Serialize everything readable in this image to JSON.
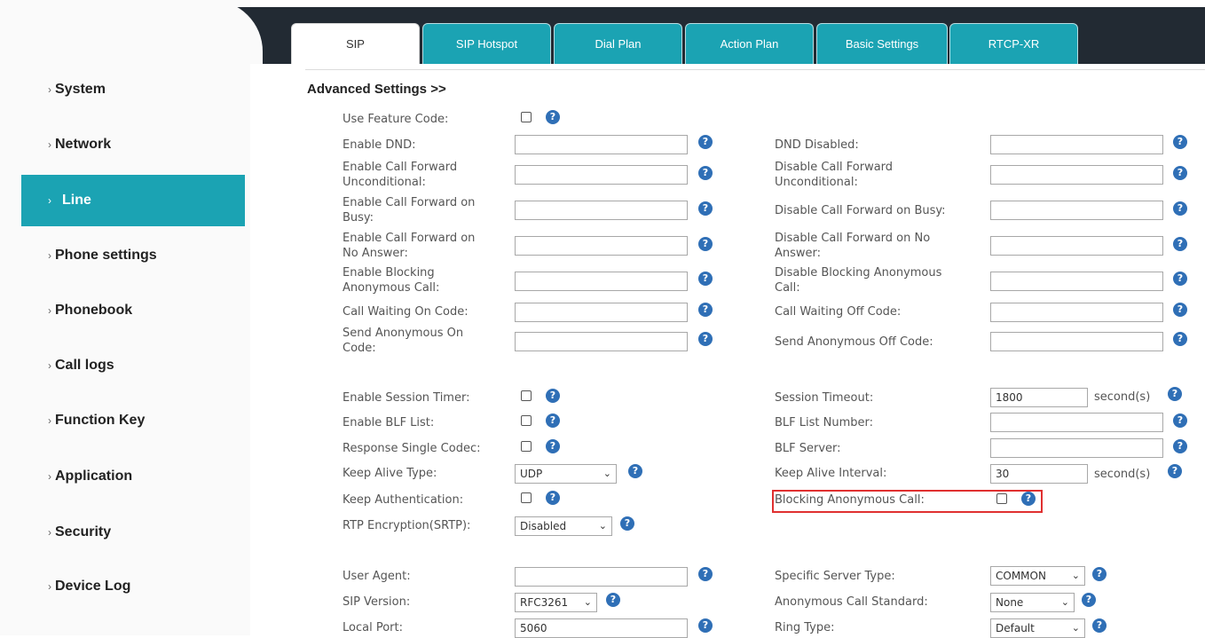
{
  "sidebar": {
    "items": [
      {
        "label": "System"
      },
      {
        "label": "Network"
      },
      {
        "label": "Line"
      },
      {
        "label": "Phone settings"
      },
      {
        "label": "Phonebook"
      },
      {
        "label": "Call logs"
      },
      {
        "label": "Function Key"
      },
      {
        "label": "Application"
      },
      {
        "label": "Security"
      },
      {
        "label": "Device Log"
      }
    ],
    "active": "Line"
  },
  "tabs": [
    {
      "label": "SIP"
    },
    {
      "label": "SIP Hotspot"
    },
    {
      "label": "Dial Plan"
    },
    {
      "label": "Action Plan"
    },
    {
      "label": "Basic Settings"
    },
    {
      "label": "RTCP-XR"
    }
  ],
  "section_title": "Advanced Settings >>",
  "fields": {
    "use_feature_code": {
      "label": "Use Feature Code:",
      "checked": false
    },
    "enable_dnd": {
      "label": "Enable DND:",
      "value": ""
    },
    "dnd_disabled": {
      "label": "DND Disabled:",
      "value": ""
    },
    "enable_cfu": {
      "label_1": "Enable Call Forward",
      "label_2": "Unconditional:",
      "value": ""
    },
    "disable_cfu": {
      "label_1": "Disable Call Forward",
      "label_2": "Unconditional:",
      "value": ""
    },
    "enable_cfb": {
      "label_1": "Enable Call Forward on",
      "label_2": "Busy:",
      "value": ""
    },
    "disable_cfb": {
      "label": "Disable Call Forward on Busy:",
      "value": ""
    },
    "enable_cfna": {
      "label_1": "Enable Call Forward on",
      "label_2": "No Answer:",
      "value": ""
    },
    "disable_cfna": {
      "label_1": "Disable Call Forward on No",
      "label_2": "Answer:",
      "value": ""
    },
    "enable_block_anon": {
      "label_1": "Enable Blocking",
      "label_2": "Anonymous Call:",
      "value": ""
    },
    "disable_block_anon": {
      "label_1": "Disable Blocking Anonymous",
      "label_2": "Call:",
      "value": ""
    },
    "call_waiting_on": {
      "label": "Call Waiting On Code:",
      "value": ""
    },
    "call_waiting_off": {
      "label": "Call Waiting Off Code:",
      "value": ""
    },
    "send_anon_on": {
      "label_1": "Send Anonymous On",
      "label_2": "Code:",
      "value": ""
    },
    "send_anon_off": {
      "label": "Send Anonymous Off Code:",
      "value": ""
    },
    "enable_session_timer": {
      "label": "Enable Session Timer:",
      "checked": false
    },
    "session_timeout": {
      "label": "Session Timeout:",
      "value": "1800",
      "unit": "second(s)"
    },
    "enable_blf_list": {
      "label": "Enable BLF List:",
      "checked": false
    },
    "blf_list_number": {
      "label": "BLF List Number:",
      "value": ""
    },
    "response_single_codec": {
      "label": "Response Single Codec:",
      "checked": false
    },
    "blf_server": {
      "label": "BLF Server:",
      "value": ""
    },
    "keep_alive_type": {
      "label": "Keep Alive Type:",
      "value": "UDP"
    },
    "keep_alive_interval": {
      "label": "Keep Alive Interval:",
      "value": "30",
      "unit": "second(s)"
    },
    "keep_authentication": {
      "label": "Keep Authentication:",
      "checked": false
    },
    "blocking_anon_call": {
      "label": "Blocking Anonymous Call:",
      "checked": false
    },
    "rtp_encryption": {
      "label": "RTP Encryption(SRTP):",
      "value": "Disabled"
    },
    "user_agent": {
      "label": "User Agent:",
      "value": ""
    },
    "specific_server_type": {
      "label": "Specific Server Type:",
      "value": "COMMON"
    },
    "sip_version": {
      "label": "SIP Version:",
      "value": "RFC3261"
    },
    "anon_call_standard": {
      "label": "Anonymous Call Standard:",
      "value": "None"
    },
    "local_port": {
      "label": "Local Port:",
      "value": "5060"
    },
    "ring_type": {
      "label": "Ring Type:",
      "value": "Default"
    }
  },
  "help_glyph": "?",
  "chevron_glyph": "›",
  "dropdown_glyph": "⌄",
  "colors": {
    "accent": "#1ba3b3",
    "topbar": "#222a33",
    "help": "#2f6fb6",
    "highlight": "#e03030"
  }
}
